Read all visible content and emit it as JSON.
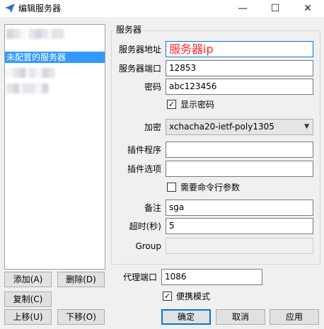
{
  "window": {
    "title": "编辑服务器",
    "minimize_label": "—",
    "maximize_label": "☐",
    "close_label": "✕"
  },
  "server_list": {
    "items": [
      {
        "label": "▓▒░ ▒▓▒ ▒▒",
        "blurred": true
      },
      {
        "label": "未配置的服务器",
        "selected": true
      },
      {
        "label": "░▒▓ ▒░▓▒",
        "blurred": true
      },
      {
        "label": "▒▓ ▒▒░▓",
        "blurred": true
      }
    ]
  },
  "group": {
    "title": "服务器"
  },
  "fields": {
    "server_address": {
      "label": "服务器地址",
      "value": "服务器ip"
    },
    "server_port": {
      "label": "服务器端口",
      "value": "12853"
    },
    "password": {
      "label": "密码",
      "value": "abc123456"
    },
    "show_password": {
      "label": "显示密码",
      "checked": true
    },
    "encryption": {
      "label": "加密",
      "value": "xchacha20-ietf-poly1305"
    },
    "plugin": {
      "label": "插件程序",
      "value": ""
    },
    "plugin_options": {
      "label": "插件选项",
      "value": ""
    },
    "plugin_args": {
      "label": "需要命令行参数",
      "checked": false
    },
    "remarks": {
      "label": "备注",
      "value": "sga"
    },
    "timeout": {
      "label": "超时(秒)",
      "value": "5"
    },
    "group_field": {
      "label": "Group",
      "value": ""
    }
  },
  "proxy": {
    "port_label": "代理端口",
    "port_value": "1086",
    "portable_label": "便携模式",
    "portable_checked": true
  },
  "buttons": {
    "add": "添加(A)",
    "delete": "删除(D)",
    "copy": "复制(C)",
    "move_up": "上移(U)",
    "move_down": "下移(O)",
    "ok": "确定",
    "cancel": "取消",
    "apply": "应用"
  }
}
